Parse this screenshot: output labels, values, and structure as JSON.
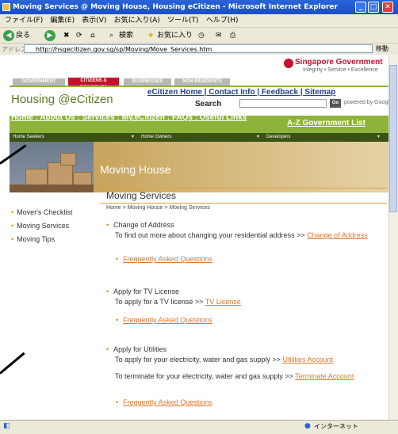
{
  "window": {
    "title": "Moving Services @ Moving House, Housing eCitizen - Microsoft Internet Explorer",
    "buttons": {
      "minimize": "_",
      "maximize": "□",
      "close": "✕"
    }
  },
  "menu": [
    "ファイル(F)",
    "編集(E)",
    "表示(V)",
    "お気に入り(A)",
    "ツール(T)",
    "ヘルプ(H)"
  ],
  "toolbar": {
    "back": "戻る",
    "search": "検索",
    "favorites": "お気に入り"
  },
  "addressbar": {
    "label": "アドレス(D)",
    "url": "http://hsgecitizen.gov.sg/sp/Moving/Move_Services.htm",
    "go": "移動"
  },
  "brand": {
    "name": "Singapore Government",
    "tagline": "Integrity • Service • Excellence"
  },
  "tabs": [
    "GOVERNMENT",
    "CITIZENS & RESIDENTS",
    "BUSINESSES",
    "NON-RESIDENTS"
  ],
  "site": {
    "title_prefix": "Housing ",
    "title_at": "@",
    "title_suffix": "eCitizen"
  },
  "toplinks": "eCitizen Home | Contact Info | Feedback | Sitemap",
  "search": {
    "label": "Search",
    "go": "Go",
    "powered": "powered by Google"
  },
  "nav": {
    "links": "Home : About Us : Services : My.eCitizen : FAQs : Useful Links",
    "az": "A-Z Government List"
  },
  "subnav": [
    "Home Seekers",
    "Home Owners",
    "Developers"
  ],
  "hero": {
    "title": "Moving House"
  },
  "sidenav": [
    "Mover's Checklist",
    "Moving Services",
    "Moving Tips"
  ],
  "main": {
    "title": "Moving Services",
    "breadcrumb": "Home > Moving House > Moving Services",
    "sections": [
      {
        "heading": "Change of Address",
        "text": "To find out more about changing your residential address >> ",
        "link": "Change of Address",
        "faq": "Frequently Asked Questions"
      },
      {
        "heading": "Apply for TV License",
        "text": "To apply for a TV license >> ",
        "link": "TV License",
        "faq": "Frequently Asked Questions"
      },
      {
        "heading": "Apply for Utilities",
        "text": "To apply for your electricity, water and gas supply >> ",
        "link": "Utilities Account",
        "text2": "To terminate for your electricity, water and gas supply >> ",
        "link2": "Terminate Account",
        "faq": "Frequently Asked Questions"
      }
    ]
  },
  "status": {
    "zone": "インターネット"
  }
}
